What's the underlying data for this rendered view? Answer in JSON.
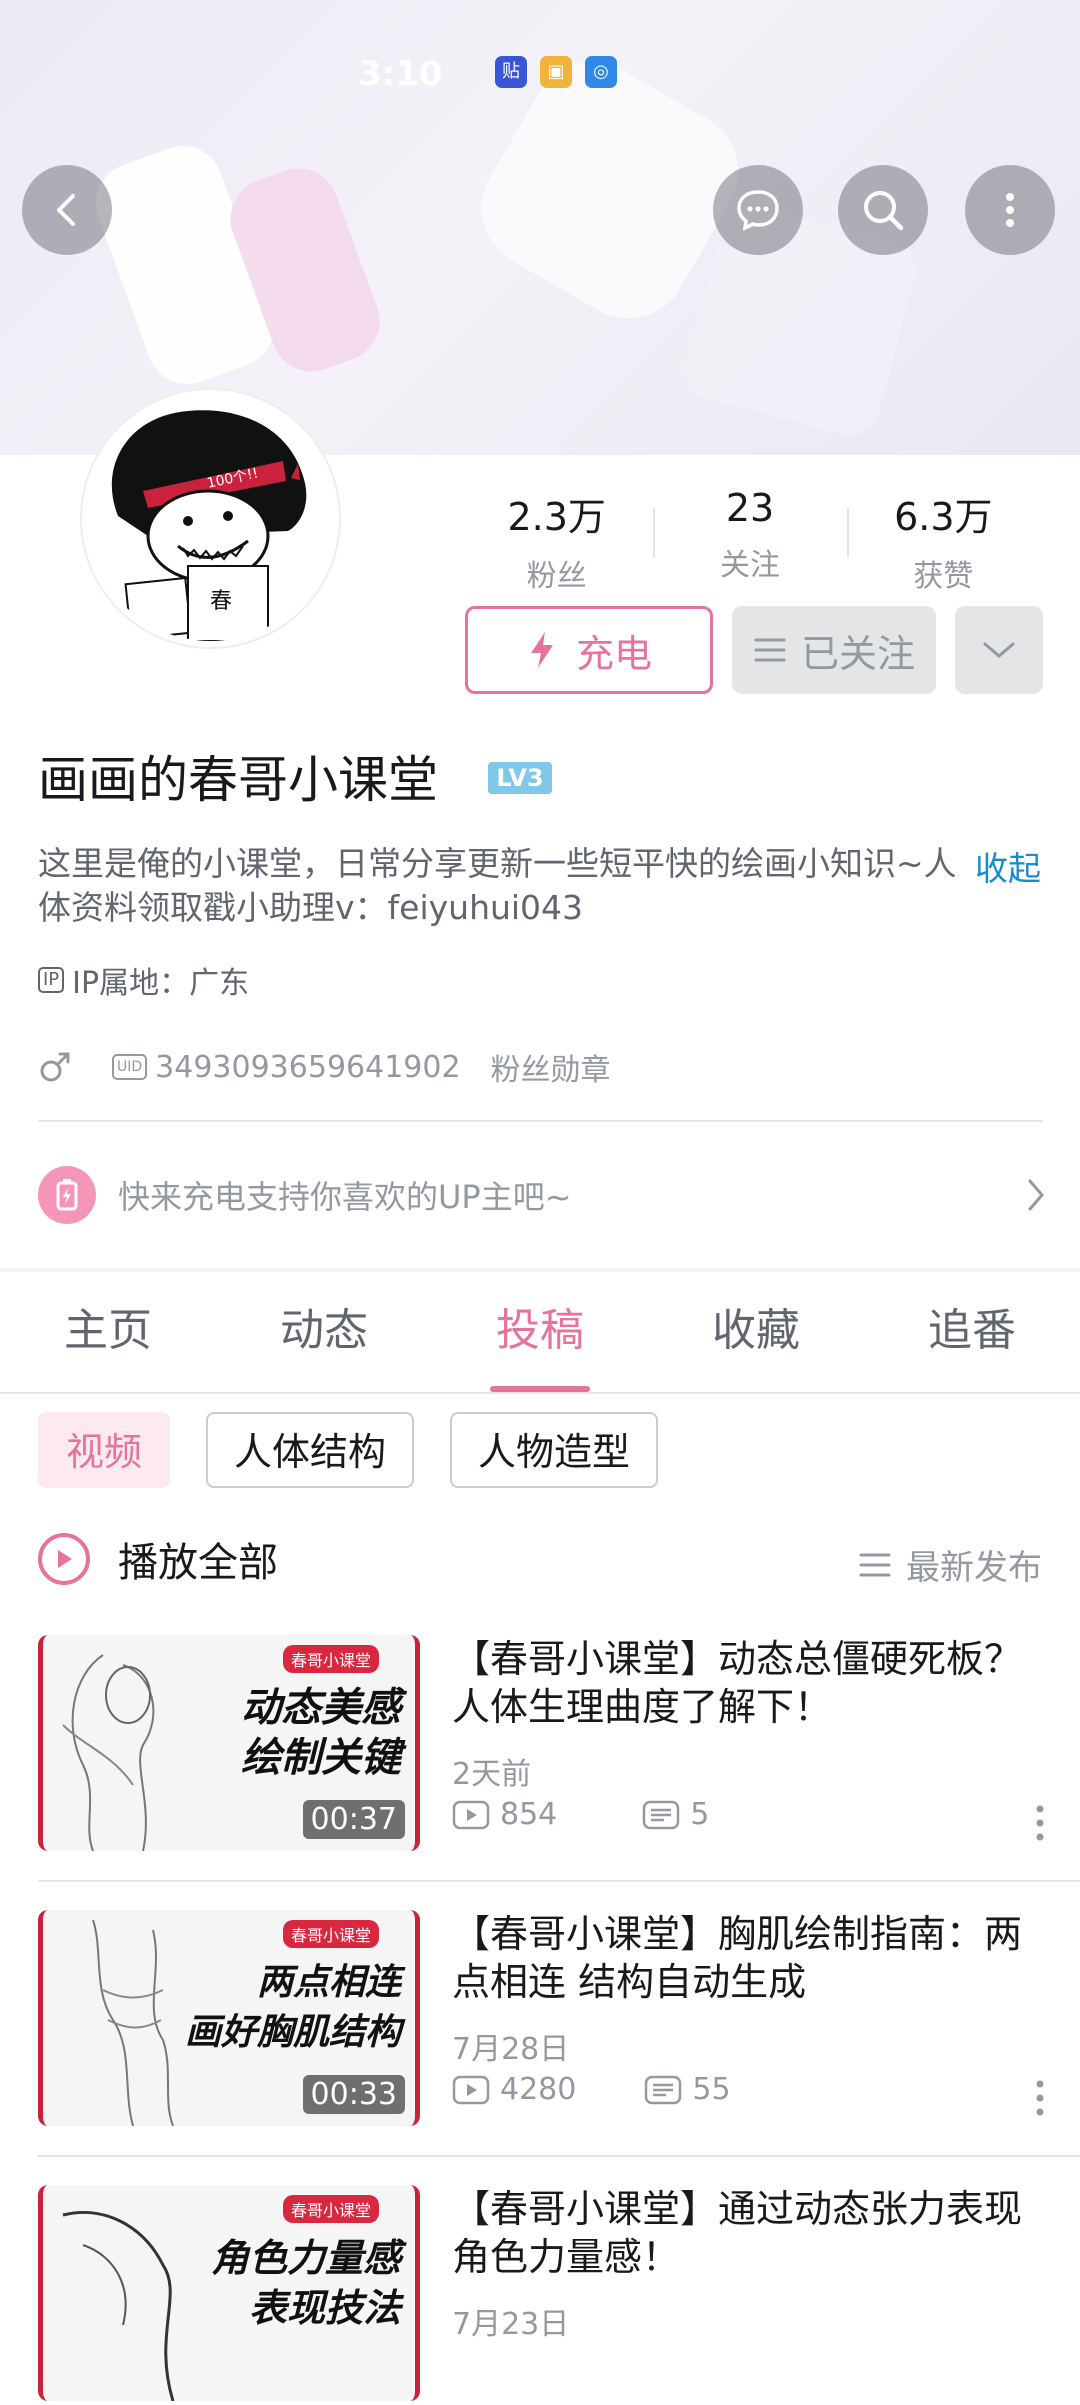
{
  "status": {
    "time": "3:10"
  },
  "stats": [
    {
      "value": "2.3万",
      "label": "粉丝"
    },
    {
      "value": "23",
      "label": "关注"
    },
    {
      "value": "6.3万",
      "label": "获赞"
    }
  ],
  "actions": {
    "charge": "充电",
    "follow": "已关注"
  },
  "profile": {
    "name": "画画的春哥小课堂",
    "level": "LV3",
    "bio": "这里是俺的小课堂，日常分享更新一些短平快的绘画小知识~人体资料领取戳小助理v：feiyuhui043",
    "bio_toggle": "收起",
    "ip_tag": "IP",
    "ip": "IP属地：广东",
    "uid_tag": "UID",
    "uid": "3493093659641902",
    "fan_medal": "粉丝勋章"
  },
  "charge_prompt": "快来充电支持你喜欢的UP主吧~",
  "tabs": [
    "主页",
    "动态",
    "投稿",
    "收藏",
    "追番"
  ],
  "active_tab": "投稿",
  "chips": [
    "视频",
    "人体结构",
    "人物造型"
  ],
  "play_all": "播放全部",
  "sort": "最新发布",
  "avatar_text": {
    "headband": "100个!!",
    "shirt": "春"
  },
  "videos": [
    {
      "thumb_badge": "春哥小课堂",
      "thumb_headline": "动态美感\n绘制关键",
      "duration": "00:37",
      "title": "【春哥小课堂】动态总僵硬死板？人体生理曲度了解下！",
      "date": "2天前",
      "views": "854",
      "comments": "5"
    },
    {
      "thumb_badge": "春哥小课堂",
      "thumb_headline": "两点相连\n画好胸肌结构",
      "duration": "00:33",
      "title": "【春哥小课堂】胸肌绘制指南：两点相连 结构自动生成",
      "date": "7月28日",
      "views": "4280",
      "comments": "55"
    },
    {
      "thumb_badge": "春哥小课堂",
      "thumb_headline": "角色力量感\n表现技法",
      "duration": "",
      "title": "【春哥小课堂】通过动态张力表现角色力量感！",
      "date": "7月23日",
      "views": "",
      "comments": ""
    }
  ],
  "colors": {
    "accent": "#e5739c",
    "link": "#178bcf",
    "muted": "#9499a0"
  }
}
